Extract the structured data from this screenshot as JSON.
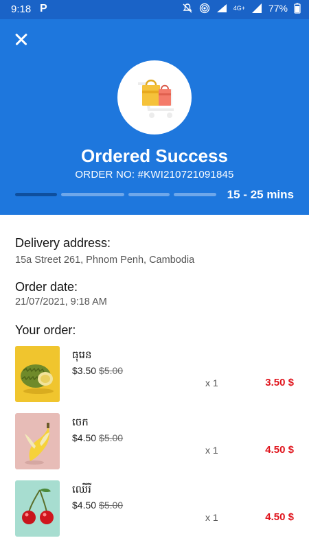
{
  "status_bar": {
    "time": "9:18",
    "battery": "77%",
    "network": "4G+"
  },
  "header": {
    "title": "Ordered Success",
    "order_no": "ORDER NO: #KWI210721091845",
    "eta": "15 - 25 mins",
    "progress_active_steps": 1,
    "progress_total_steps": 4
  },
  "delivery": {
    "label": "Delivery address:",
    "value": "15a Street 261, Phnom Penh, Cambodia"
  },
  "order_date": {
    "label": "Order date:",
    "value": "21/07/2021, 9:18 AM"
  },
  "your_order_label": "Your order:",
  "items": [
    {
      "name": "ធុរេន",
      "price": "$3.50",
      "old_price": "$5.00",
      "qty": "x 1",
      "total": "3.50 $",
      "image": "durian"
    },
    {
      "name": "ចេក",
      "price": "$4.50",
      "old_price": "$5.00",
      "qty": "x 1",
      "total": "4.50 $",
      "image": "banana"
    },
    {
      "name": "ឈើរី",
      "price": "$4.50",
      "old_price": "$5.00",
      "qty": "x 1",
      "total": "4.50 $",
      "image": "cherry"
    }
  ],
  "colors": {
    "header_bg": "#1e77dd",
    "status_bg": "#1a63c7",
    "total_red": "#e0141c"
  }
}
